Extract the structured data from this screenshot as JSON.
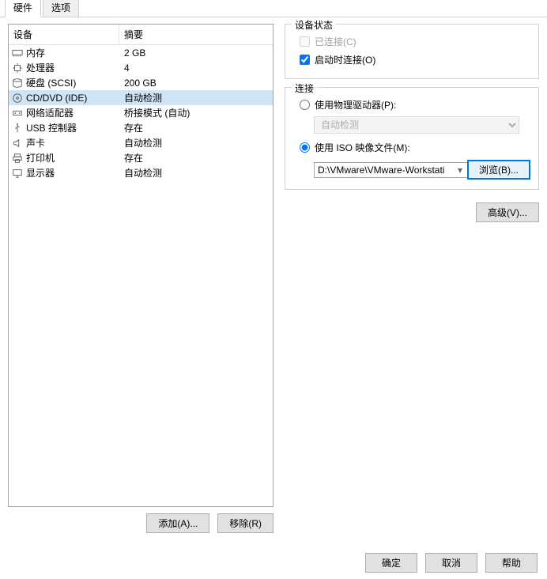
{
  "tabs": {
    "hardware": "硬件",
    "options": "选项"
  },
  "columns": {
    "device": "设备",
    "summary": "摘要"
  },
  "devices": [
    {
      "name": "内存",
      "summary": "2 GB",
      "icon": "memory"
    },
    {
      "name": "处理器",
      "summary": "4",
      "icon": "cpu"
    },
    {
      "name": "硬盘 (SCSI)",
      "summary": "200 GB",
      "icon": "disk"
    },
    {
      "name": "CD/DVD (IDE)",
      "summary": "自动检测",
      "icon": "cd",
      "selected": true
    },
    {
      "name": "网络适配器",
      "summary": "桥接模式 (自动)",
      "icon": "net"
    },
    {
      "name": "USB 控制器",
      "summary": "存在",
      "icon": "usb"
    },
    {
      "name": "声卡",
      "summary": "自动检测",
      "icon": "sound"
    },
    {
      "name": "打印机",
      "summary": "存在",
      "icon": "printer"
    },
    {
      "name": "显示器",
      "summary": "自动检测",
      "icon": "display"
    }
  ],
  "buttons": {
    "add": "添加(A)...",
    "remove": "移除(R)",
    "browse": "浏览(B)...",
    "advanced": "高级(V)...",
    "ok": "确定",
    "cancel": "取消",
    "help": "帮助"
  },
  "status_group": {
    "title": "设备状态",
    "connected": "已连接(C)",
    "connect_on_start": "启动时连接(O)"
  },
  "connection_group": {
    "title": "连接",
    "use_physical": "使用物理驱动器(P):",
    "auto_detect": "自动检测",
    "use_iso": "使用 ISO 映像文件(M):",
    "iso_path": "D:\\VMware\\VMware-Workstati"
  }
}
